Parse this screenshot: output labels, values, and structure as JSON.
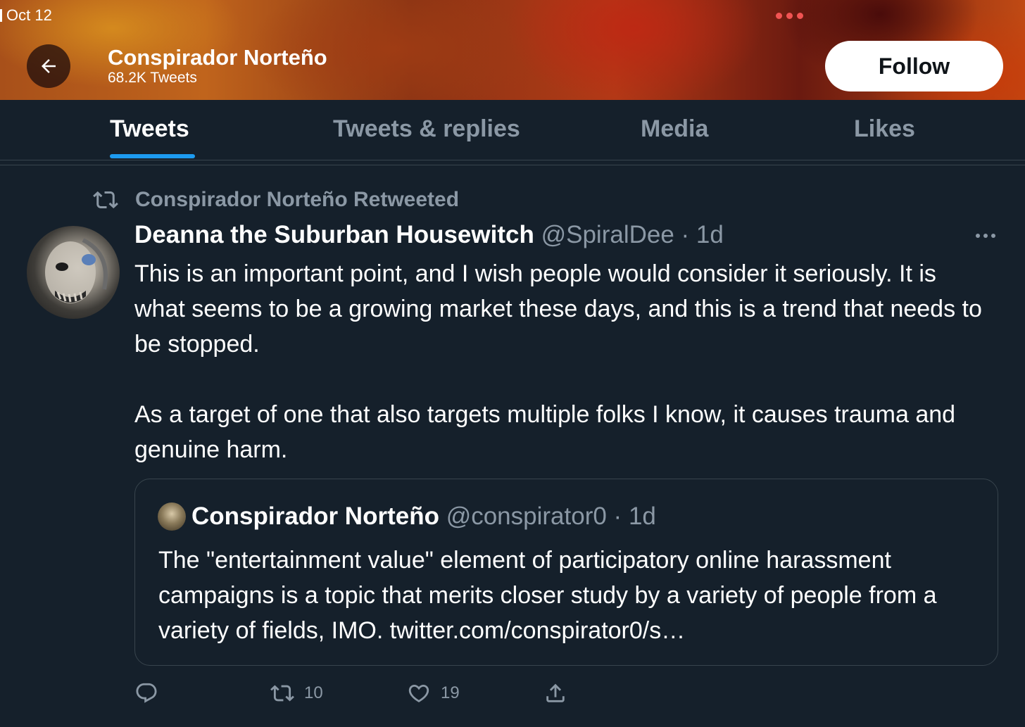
{
  "status_bar": {
    "date": "Oct 12"
  },
  "header": {
    "profile_name": "Conspirador Norteño",
    "tweet_count": "68.2K Tweets",
    "follow_label": "Follow"
  },
  "tabs": [
    {
      "label": "Tweets",
      "active": true
    },
    {
      "label": "Tweets & replies",
      "active": false
    },
    {
      "label": "Media",
      "active": false
    },
    {
      "label": "Likes",
      "active": false
    }
  ],
  "tweet": {
    "retweet_label": "Conspirador Norteño Retweeted",
    "author_name": "Deanna the Suburban Housewitch",
    "author_handle": "@SpiralDee",
    "separator": "·",
    "time": "1d",
    "paragraphs": [
      "This is an important point, and I wish people would consider it seriously. It is what seems to be a growing market these days, and this is a trend that needs to be stopped.",
      "As a target of one that also targets multiple folks I know, it causes trauma and genuine harm."
    ],
    "quote": {
      "author_name": "Conspirador Norteño",
      "author_handle": "@conspirator0",
      "separator": "·",
      "time": "1d",
      "text": "The \"entertainment value\" element of participatory online harassment campaigns is a topic that merits closer study by a variety of people from a variety of fields, IMO. twitter.com/conspirator0/s…"
    },
    "actions": {
      "reply_icon": "reply-icon",
      "retweet_icon": "retweet-icon",
      "retweet_count": "10",
      "like_icon": "heart-icon",
      "like_count": "19",
      "share_icon": "share-icon"
    }
  },
  "colors": {
    "background": "#15202b",
    "secondary_text": "#8b98a5",
    "accent": "#1d9bf0",
    "border": "#38444d"
  }
}
